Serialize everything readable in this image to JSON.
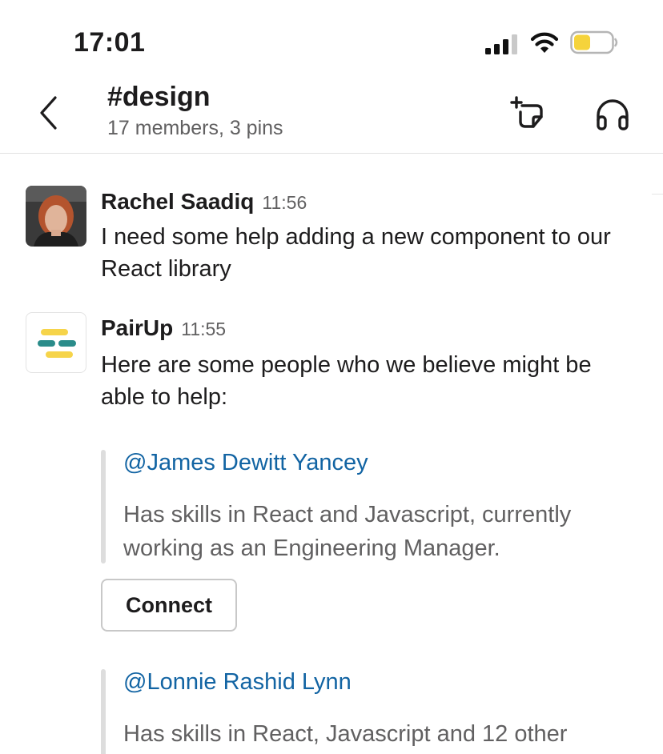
{
  "status_bar": {
    "time": "17:01",
    "battery_color": "#f5d33b"
  },
  "header": {
    "channel_name": "#design",
    "channel_meta": "17 members, 3 pins",
    "back_icon": "chevron-left-icon",
    "canvas_icon": "new-canvas-icon",
    "huddle_icon": "headphones-icon"
  },
  "messages": [
    {
      "author": "Rachel Saadiq",
      "time": "11:56",
      "text": "I need some help adding a new component to our React library"
    },
    {
      "author": "PairUp",
      "time": "11:55",
      "text": "Here are some people who we believe might be able to help:",
      "attachments": [
        {
          "mention": "@James Dewitt Yancey",
          "description": "Has skills in React and Javascript, currently working as an Engineering Manager.",
          "button_label": "Connect"
        },
        {
          "mention": "@Lonnie Rashid Lynn",
          "description": "Has skills in React, Javascript and 12 other"
        }
      ]
    }
  ],
  "colors": {
    "link": "#1264a3",
    "muted_text": "#616061",
    "pairup_yellow": "#f6d44a",
    "pairup_teal": "#2a8c8a"
  }
}
